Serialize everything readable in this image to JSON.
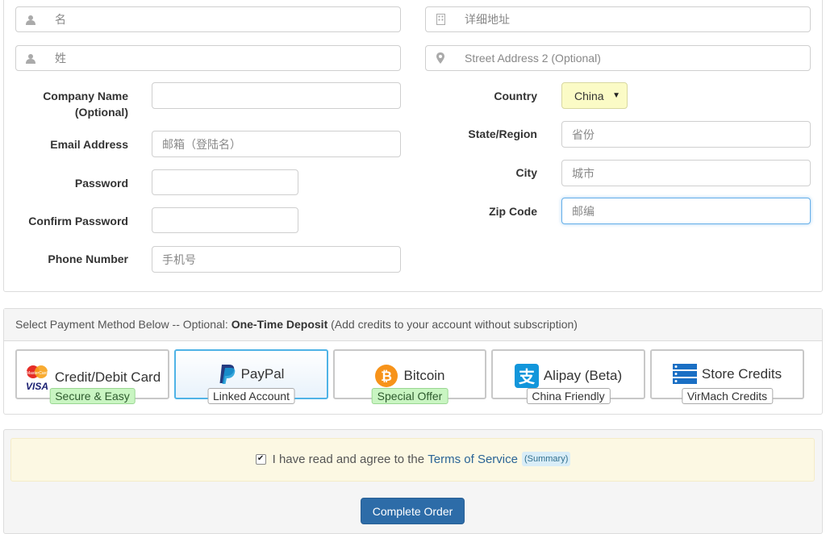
{
  "form": {
    "first_name": {
      "placeholder": "名"
    },
    "last_name": {
      "placeholder": "姓"
    },
    "address1": {
      "placeholder": "详细地址"
    },
    "address2": {
      "placeholder": "Street Address 2 (Optional)"
    },
    "company": {
      "label": "Company Name",
      "label2": "(Optional)",
      "value": ""
    },
    "email": {
      "label": "Email Address",
      "placeholder": "邮箱（登陆名）"
    },
    "password": {
      "label": "Password",
      "value": ""
    },
    "confirm_password": {
      "label": "Confirm Password",
      "value": ""
    },
    "phone": {
      "label": "Phone Number",
      "placeholder": "手机号"
    },
    "country": {
      "label": "Country",
      "value": "China"
    },
    "state": {
      "label": "State/Region",
      "placeholder": "省份"
    },
    "city": {
      "label": "City",
      "placeholder": "城市"
    },
    "zip": {
      "label": "Zip Code",
      "placeholder": "邮编"
    }
  },
  "payment": {
    "header_prefix": "Select Payment Method Below -- Optional: ",
    "header_bold": "One-Time Deposit",
    "header_suffix": " (Add credits to your account without subscription)",
    "methods": [
      {
        "name": "Credit/Debit Card",
        "badge": "Secure & Easy",
        "icon": "credit-card-icon"
      },
      {
        "name": "PayPal",
        "badge": "Linked Account",
        "icon": "paypal-icon"
      },
      {
        "name": "Bitcoin",
        "badge": "Special Offer",
        "icon": "bitcoin-icon"
      },
      {
        "name": "Alipay (Beta)",
        "badge": "China Friendly",
        "icon": "alipay-icon"
      },
      {
        "name": "Store Credits",
        "badge": "VirMach Credits",
        "icon": "store-credits-icon"
      }
    ],
    "selected": "PayPal"
  },
  "tos": {
    "prefix": "I have read and agree to the ",
    "link": "Terms of Service",
    "summary": "(Summary)",
    "checked": true
  },
  "submit": {
    "label": "Complete Order"
  },
  "colors": {
    "accent": "#2d6ca8",
    "green_badge": "#c9f5c2",
    "country_bg": "#fbfbc6",
    "tos_bg": "#fcf8e3",
    "paypal_active": "#4fb3e6"
  }
}
